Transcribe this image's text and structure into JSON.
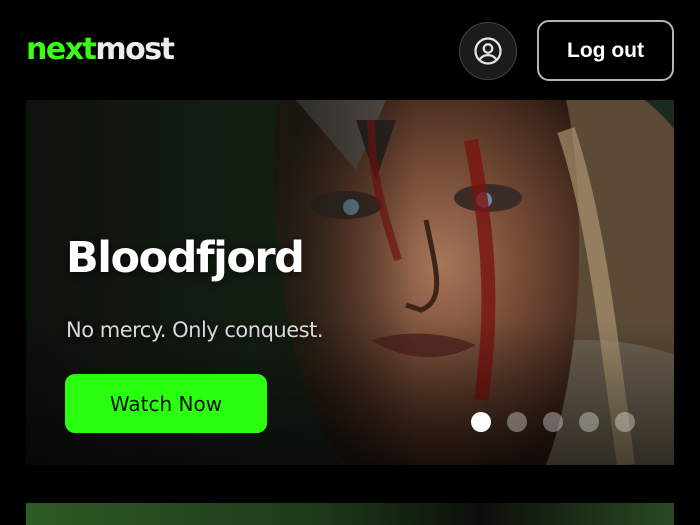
{
  "header": {
    "logo_accent": "next",
    "logo_rest": "most",
    "profile_icon": "user-circle-icon",
    "logout_label": "Log out"
  },
  "hero": {
    "title": "Bloodfjord",
    "subtitle": "No mercy. Only conquest.",
    "cta_label": "Watch Now",
    "slides_total": 5,
    "active_slide": 1
  },
  "colors": {
    "brand_green": "#39ff14",
    "cta_green": "#2bff10",
    "background": "#000000"
  }
}
